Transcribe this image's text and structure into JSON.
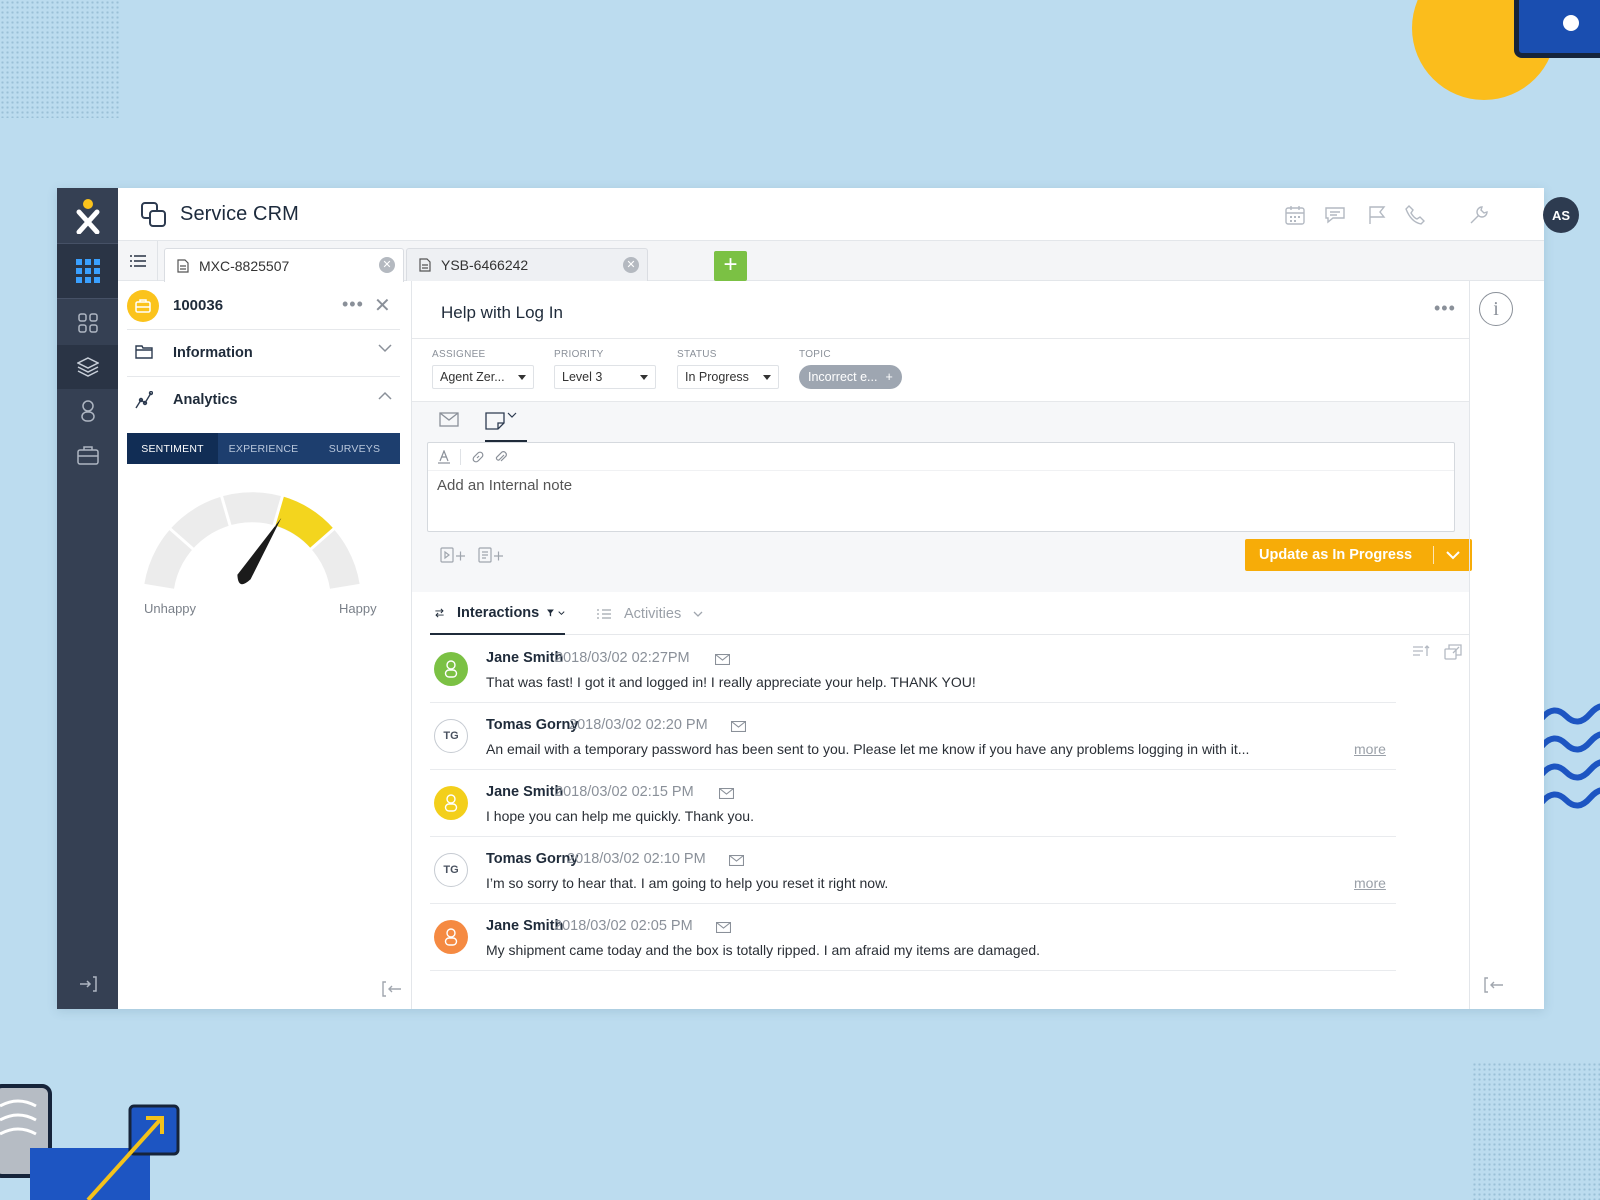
{
  "app": {
    "title": "Service CRM",
    "user_initials": "AS",
    "accent": "#f7ac08",
    "rail_color": "#354053"
  },
  "tabs": [
    {
      "label": "MXC-8825507",
      "active": true
    },
    {
      "label": "YSB-6466242",
      "active": false
    }
  ],
  "tab_add_label": "+",
  "left_panel": {
    "case_id": "100036",
    "more": "•••",
    "close": "✕",
    "sections": [
      {
        "label": "Information",
        "expanded": false
      },
      {
        "label": "Analytics",
        "expanded": true
      }
    ],
    "analytics_tabs": [
      "SENTIMENT",
      "EXPERIENCE",
      "SURVEYS"
    ],
    "active_tab": "SENTIMENT",
    "gauge": {
      "low_label": "Unhappy",
      "high_label": "Happy",
      "value": 0.62
    }
  },
  "main": {
    "title": "Help with Log In",
    "more": "•••",
    "properties": {
      "assignee": {
        "label": "ASSIGNEE",
        "value": "Agent Zer..."
      },
      "priority": {
        "label": "PRIORITY",
        "value": "Level 3"
      },
      "status": {
        "label": "STATUS",
        "value": "In Progress"
      },
      "topic": {
        "label": "TOPIC",
        "value": "Incorrect e...",
        "add": "+"
      }
    },
    "editor_placeholder": "Add an Internal note",
    "update_button": "Update as In Progress",
    "feed_tabs": [
      "Interactions",
      "Activities"
    ],
    "feed": [
      {
        "initials": "",
        "name": "Jane Smith",
        "time": "2018/03/02 02:27PM",
        "text": "That was fast! I got it and logged in! I really appreciate your help. THANK YOU!",
        "avatar_color": "#7bc144",
        "more": ""
      },
      {
        "initials": "TG",
        "name": "Tomas Gorny",
        "time": "2018/03/02 02:20 PM",
        "text": "An email with a temporary password has been sent to you. Please let me know if you have any problems logging in with it...",
        "avatar_color": "",
        "more": "more"
      },
      {
        "initials": "",
        "name": "Jane Smith",
        "time": "2018/03/02 02:15 PM",
        "text": "I hope you can help me quickly. Thank you.",
        "avatar_color": "#f3cf1b",
        "more": ""
      },
      {
        "initials": "TG",
        "name": "Tomas Gorny",
        "time": "2018/03/02 02:10 PM",
        "text": "I’m so sorry to hear that. I am going to help you reset it right now.",
        "avatar_color": "",
        "more": "more"
      },
      {
        "initials": "",
        "name": "Jane Smith",
        "time": "2018/03/02 02:05 PM",
        "text": "My shipment came today and the box is totally ripped. I am afraid my items are damaged.",
        "avatar_color": "#f58a42",
        "more": ""
      }
    ]
  }
}
